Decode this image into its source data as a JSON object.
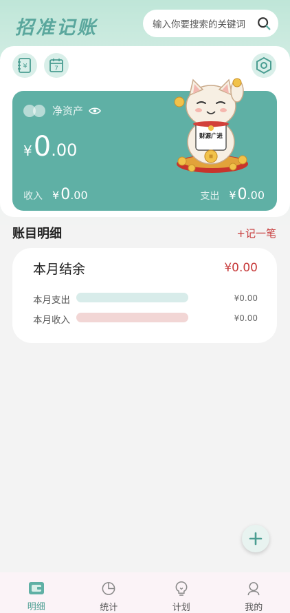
{
  "app": {
    "title": "招准记账"
  },
  "search": {
    "placeholder": "输入你要搜索的关键词"
  },
  "asset_card": {
    "label": "净资产",
    "currency": "¥",
    "amount_int": "0",
    "amount_dec": ".00",
    "income_label": "收入",
    "income_int": "0",
    "income_dec": ".00",
    "expense_label": "支出",
    "expense_int": "0",
    "expense_dec": ".00"
  },
  "cat_sign": "财源广进",
  "details": {
    "title": "账目明细",
    "add_label": "+记一笔",
    "summary_title": "本月结余",
    "summary_balance": "¥0.00",
    "rows": [
      {
        "label": "本月支出",
        "value": "¥0.00",
        "color": "#d8ecea"
      },
      {
        "label": "本月收入",
        "value": "¥0.00",
        "color": "#f2d6d5"
      }
    ]
  },
  "tabs": [
    {
      "label": "明细",
      "icon": "wallet-icon",
      "active": true
    },
    {
      "label": "统计",
      "icon": "pie-chart-icon",
      "active": false
    },
    {
      "label": "计划",
      "icon": "lightbulb-icon",
      "active": false
    },
    {
      "label": "我的",
      "icon": "profile-icon",
      "active": false
    }
  ],
  "colors": {
    "accent": "#5fb0a5",
    "red": "#c73a3a",
    "tab_active": "#4a9d91"
  }
}
